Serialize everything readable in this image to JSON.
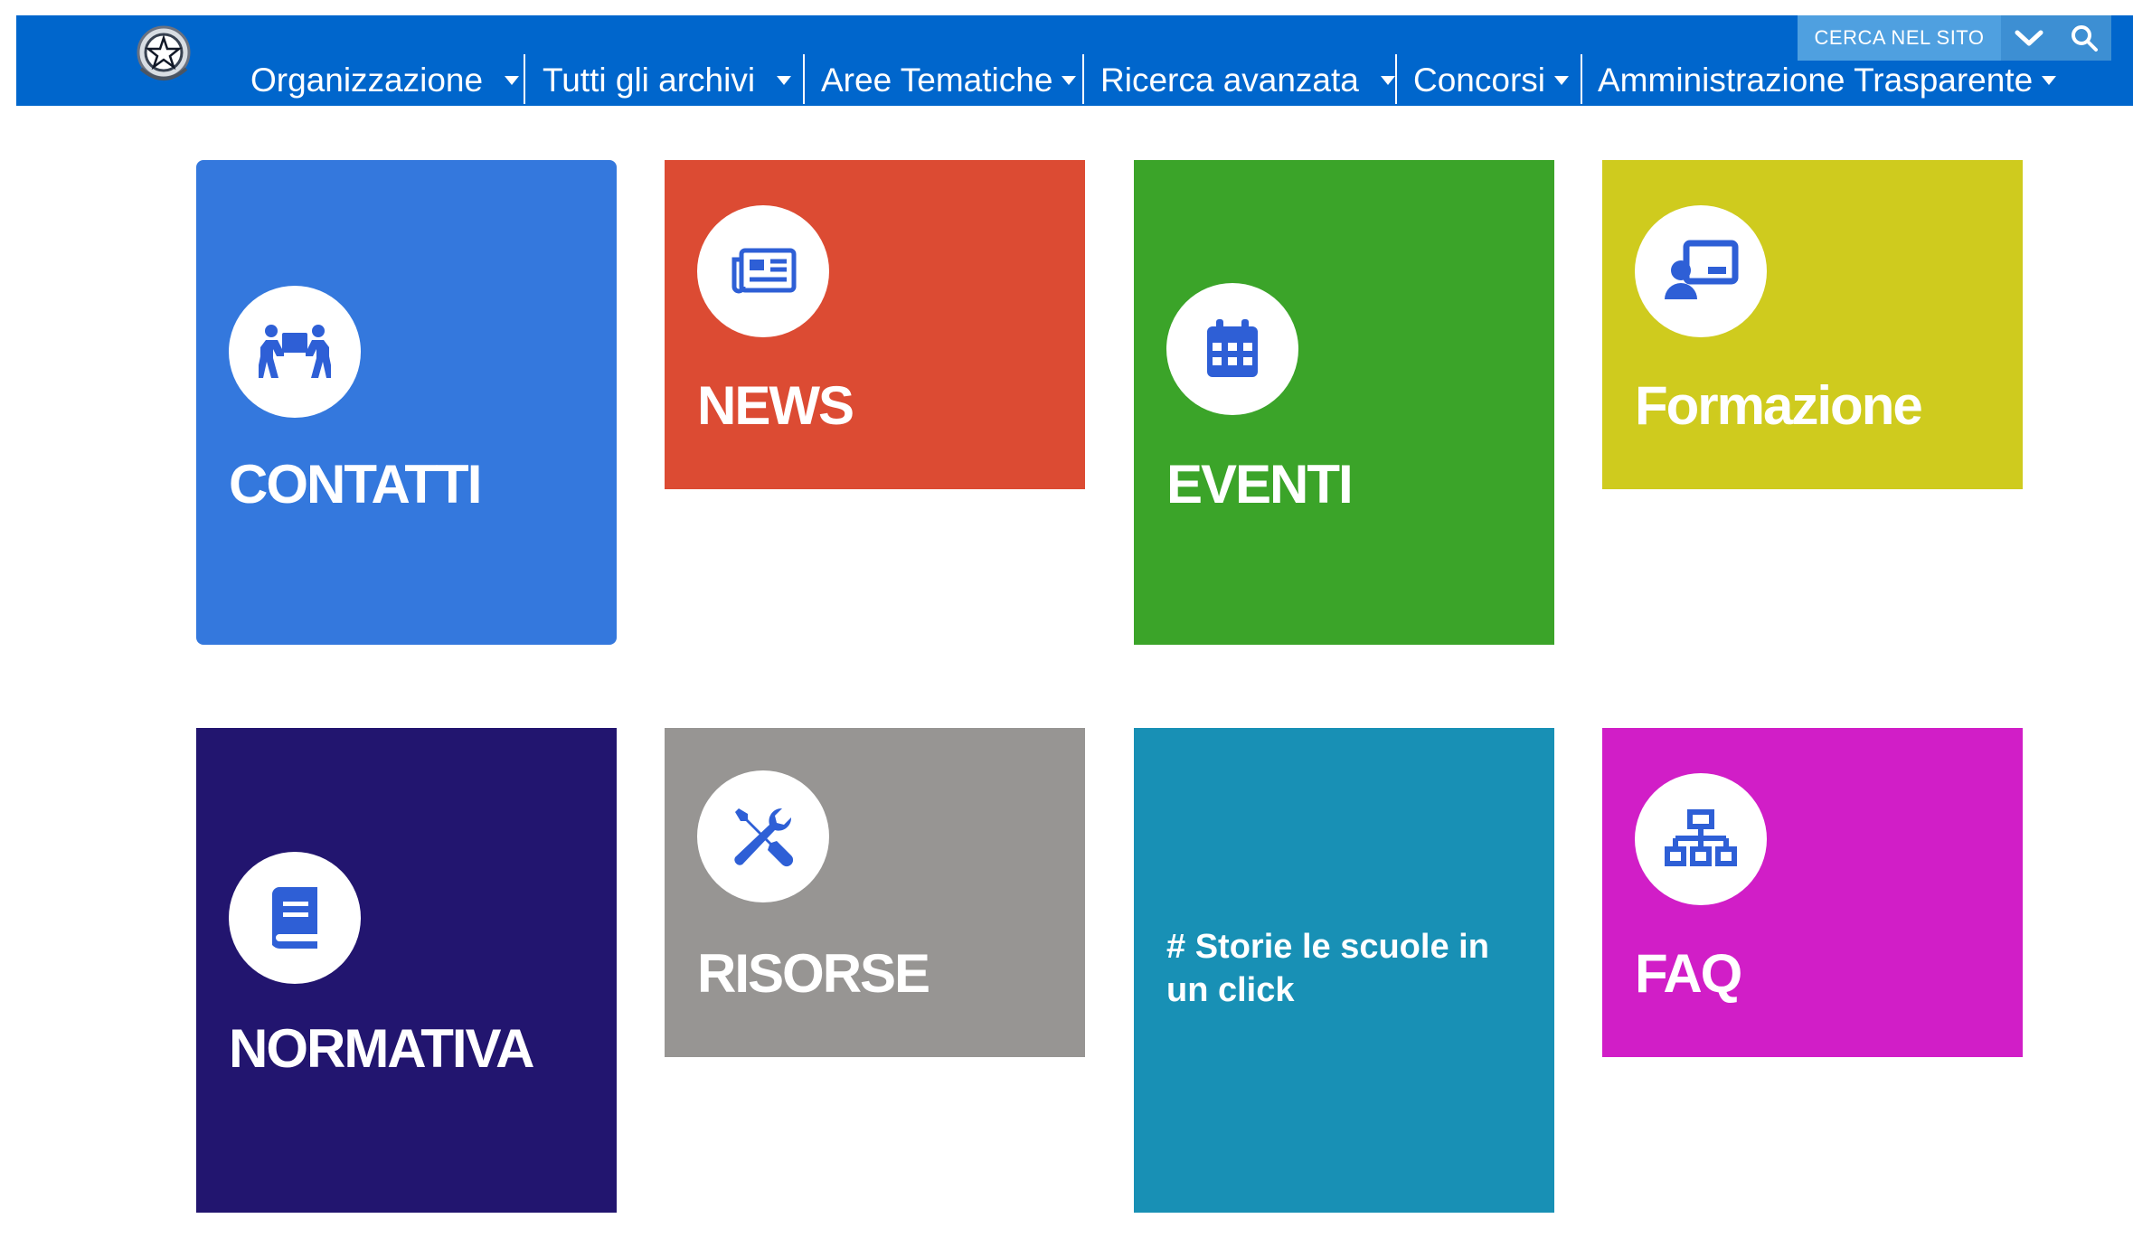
{
  "header": {
    "nav": [
      {
        "label": "Organizzazione"
      },
      {
        "label": "Tutti gli archivi"
      },
      {
        "label": "Aree Tematiche"
      },
      {
        "label": "Ricerca avanzata"
      },
      {
        "label": "Concorsi"
      },
      {
        "label": "Amministrazione Trasparente"
      }
    ],
    "search_label": "CERCA NEL SITO",
    "brand_color": "#0066cc"
  },
  "tiles": [
    {
      "label": "CONTATTI",
      "color": "#3478dd",
      "icon": "people-carry-icon"
    },
    {
      "label": "NEWS",
      "color": "#dc4b33",
      "icon": "newspaper-icon"
    },
    {
      "label": "EVENTI",
      "color": "#3ba429",
      "icon": "calendar-icon"
    },
    {
      "label": "Formazione",
      "color": "#cfcb1e",
      "icon": "teacher-board-icon"
    },
    {
      "label": "NORMATIVA",
      "color": "#22156f",
      "icon": "book-icon"
    },
    {
      "label": "RISORSE",
      "color": "#979593",
      "icon": "tools-icon"
    },
    {
      "label": "# Storie le scuole in un click",
      "color": "#1890b5",
      "icon": ""
    },
    {
      "label": "FAQ",
      "color": "#d11ec7",
      "icon": "sitemap-icon"
    }
  ],
  "icon_color": "#2e5fd6"
}
